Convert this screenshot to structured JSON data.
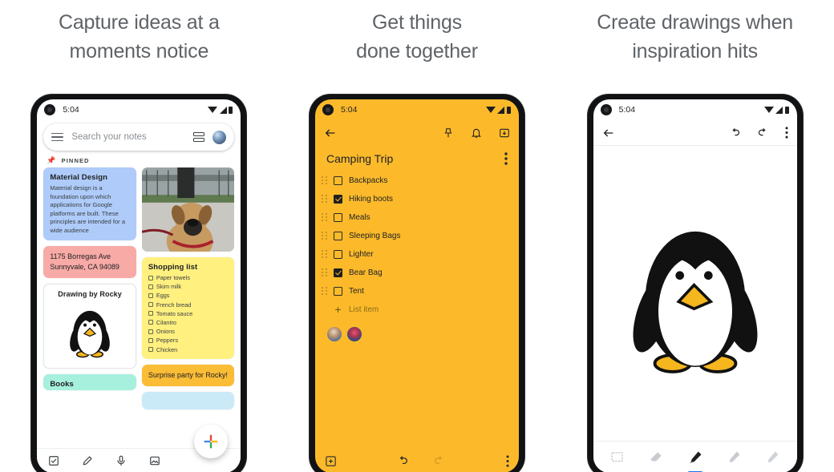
{
  "panels": [
    {
      "headline_line1": "Capture ideas at a",
      "headline_line2": "moments notice",
      "status": {
        "time": "5:04"
      },
      "search": {
        "placeholder": "Search your notes"
      },
      "section_label": "PINNED",
      "notes": {
        "material": {
          "title": "Material Design",
          "body": "Material design is a foundation upon which applications for Google platforms are built. These principles are intended for a wide audience",
          "color": "#aecbfa"
        },
        "address": {
          "text": "1175 Borregas Ave Sunnyvale, CA 94089",
          "color": "#f7aaa6"
        },
        "shopping": {
          "title": "Shopping list",
          "color": "#fff07f",
          "items": [
            "Paper towels",
            "Skim milk",
            "Eggs",
            "French bread",
            "Tomato sauce",
            "Cilantro",
            "Onions",
            "Peppers",
            "Chicken"
          ]
        },
        "drawing": {
          "title": "Drawing by Rocky"
        },
        "surprise": {
          "text": "Surprise party for Rocky!",
          "color": "#fbbc36"
        },
        "books": {
          "text": "Books",
          "color": "#a7f0dd"
        },
        "photo_alt": "dog-photo"
      },
      "bottom_tools": [
        "checkbox-icon",
        "brush-icon",
        "mic-icon",
        "image-icon"
      ],
      "fab": "add-note-fab"
    },
    {
      "headline_line1": "Get things",
      "headline_line2": "done together",
      "status": {
        "time": "5:04"
      },
      "appbar": [
        "back-arrow-icon",
        "pin-icon",
        "reminder-bell-icon",
        "archive-icon"
      ],
      "note_title": "Camping Trip",
      "checklist": [
        {
          "label": "Backpacks",
          "checked": false
        },
        {
          "label": "Hiking boots",
          "checked": true
        },
        {
          "label": "Meals",
          "checked": false
        },
        {
          "label": "Sleeping Bags",
          "checked": false
        },
        {
          "label": "Lighter",
          "checked": false
        },
        {
          "label": "Bear Bag",
          "checked": true
        },
        {
          "label": "Tent",
          "checked": false
        }
      ],
      "add_item_label": "List item",
      "collaborators": [
        "collaborator-avatar-1",
        "collaborator-avatar-2"
      ],
      "bottom_tools": [
        "add-box-icon",
        "undo-icon",
        "redo-icon",
        "more-options-icon"
      ],
      "background_color": "#fcba2b"
    },
    {
      "headline_line1": "Create drawings when",
      "headline_line2": "inspiration hits",
      "status": {
        "time": "5:04"
      },
      "appbar": [
        "back-arrow-icon",
        "undo-icon",
        "redo-icon",
        "more-options-icon"
      ],
      "canvas_content": "penguin-drawing",
      "tools": [
        {
          "name": "selection-tool",
          "active": false
        },
        {
          "name": "eraser-tool",
          "active": false
        },
        {
          "name": "pen-tool",
          "active": true
        },
        {
          "name": "pencil-tool",
          "active": false
        },
        {
          "name": "highlighter-tool",
          "active": false
        }
      ],
      "active_tool_color": "#1a73e8"
    }
  ]
}
